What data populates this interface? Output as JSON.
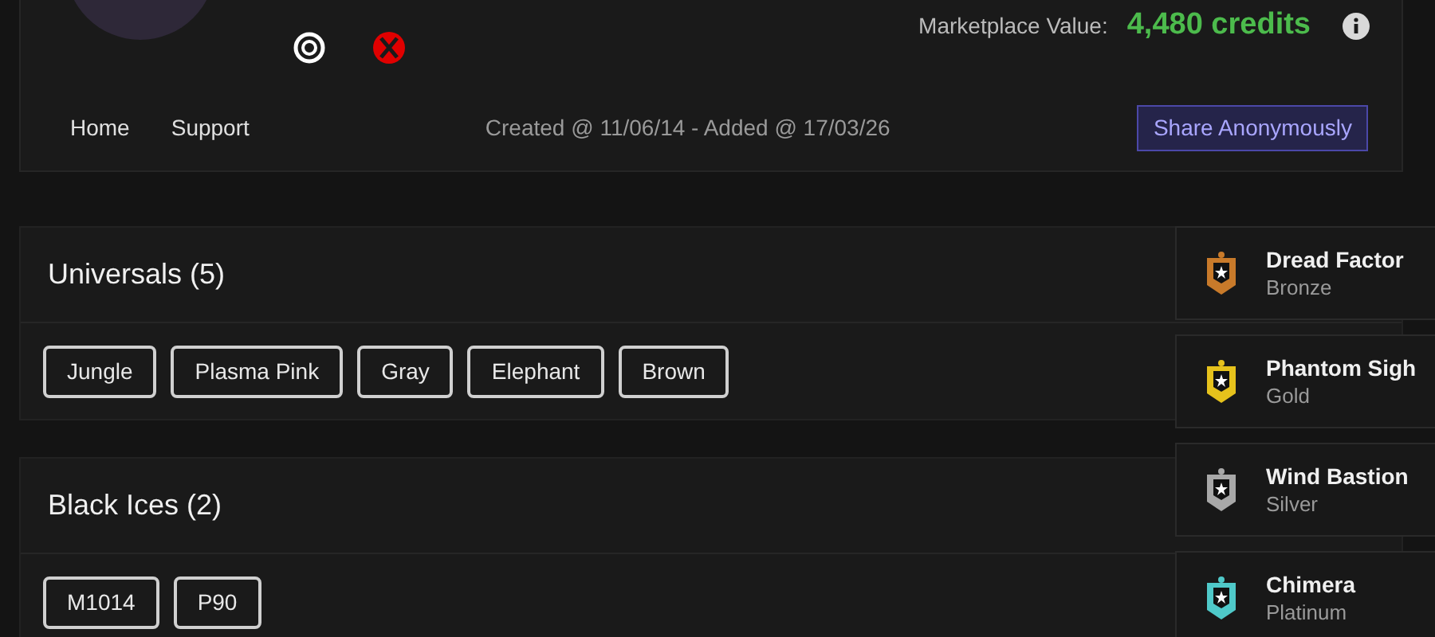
{
  "profile": {
    "marketplace_label": "Marketplace Value:",
    "marketplace_value": "4,480 credits",
    "nav": [
      {
        "label": "Home"
      },
      {
        "label": "Support"
      }
    ],
    "dates": "Created @ 11/06/14 - Added @ 17/03/26",
    "share_button": "Share Anonymously"
  },
  "sections": [
    {
      "title": "Universals (5)",
      "items": [
        "Jungle",
        "Plasma Pink",
        "Gray",
        "Elephant",
        "Brown"
      ]
    },
    {
      "title": "Black Ices (2)",
      "items": [
        "M1014",
        "P90"
      ]
    }
  ],
  "ranks": [
    {
      "season": "Dread Factor",
      "tier": "Bronze",
      "color": "#c87a2a"
    },
    {
      "season": "Phantom Sigh",
      "tier": "Gold",
      "color": "#e6c21c"
    },
    {
      "season": "Wind Bastion",
      "tier": "Silver",
      "color": "#a8a8a8"
    },
    {
      "season": "Chimera",
      "tier": "Platinum",
      "color": "#4fc9c9"
    }
  ]
}
